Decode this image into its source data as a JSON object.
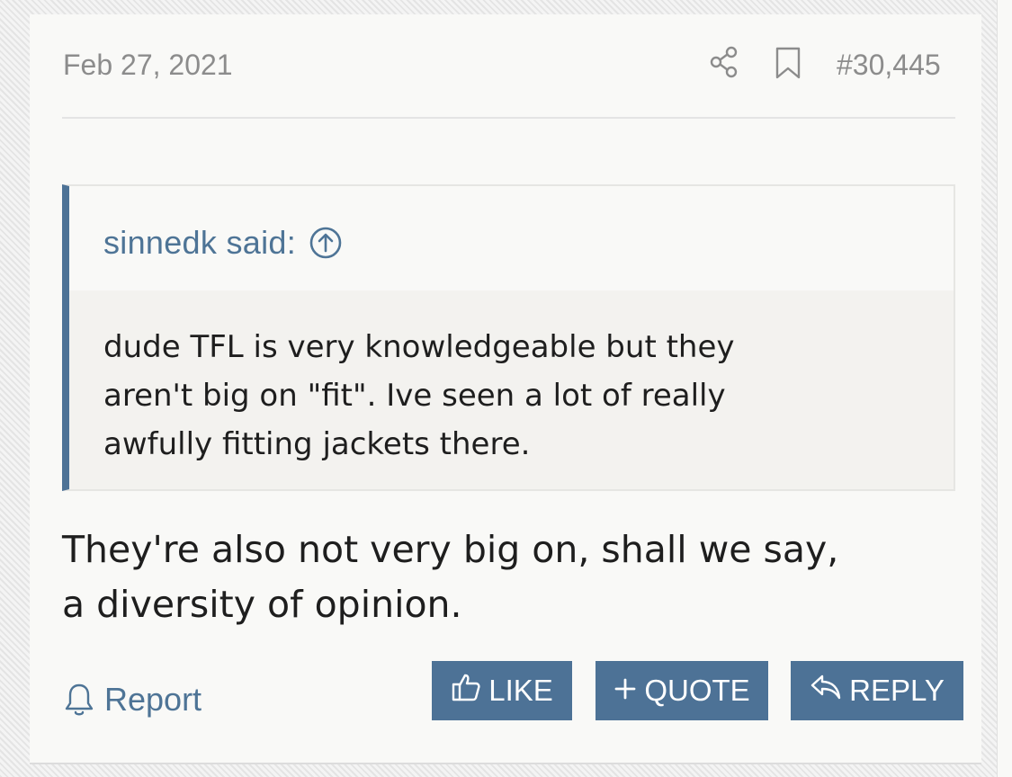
{
  "post": {
    "date": "Feb 27, 2021",
    "number": "#30,445",
    "icons": {
      "share": "share-icon",
      "bookmark": "bookmark-icon"
    }
  },
  "quote": {
    "author_label": "sinnedk said:",
    "icon": "arrow-up-circle-icon",
    "lines": [
      "dude TFL is very knowledgeable but they",
      "aren't big on \"fit\". Ive seen a lot of really",
      "awfully fitting jackets there."
    ]
  },
  "message": {
    "lines": [
      "They're also not very big on, shall we say,",
      "a diversity of opinion."
    ]
  },
  "actions": {
    "report_label": "Report",
    "like_label": "LIKE",
    "quote_label": "QUOTE",
    "reply_label": "REPLY"
  },
  "colors": {
    "accent": "#4d7296",
    "link": "#4e7496",
    "meta_text": "#8c8c8c",
    "body_text": "#1e1e1e",
    "panel": "#f9f9f7",
    "quote_bg": "#f3f2ef"
  }
}
